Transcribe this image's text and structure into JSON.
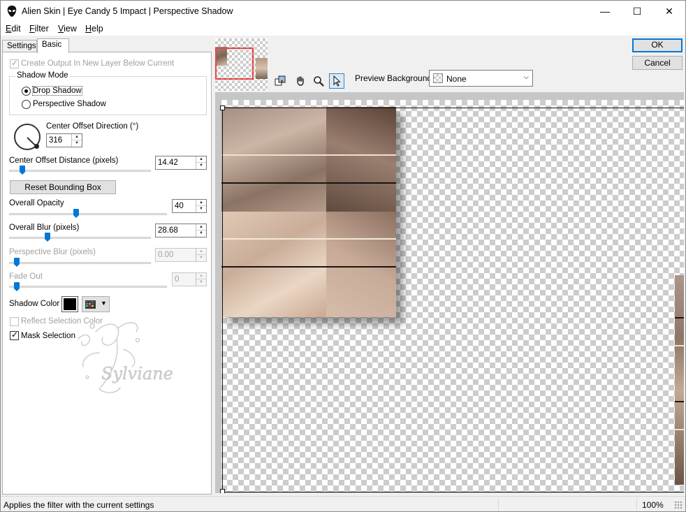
{
  "window": {
    "title": "Alien Skin | Eye Candy 5 Impact | Perspective Shadow",
    "controls": {
      "minimize": "—",
      "maximize": "☐",
      "close": "✕"
    }
  },
  "menu": [
    {
      "key": "E",
      "rest": "dit"
    },
    {
      "key": "F",
      "rest": "ilter"
    },
    {
      "key": "V",
      "rest": "iew"
    },
    {
      "key": "H",
      "rest": "elp"
    }
  ],
  "tabs": {
    "settings": "Settings",
    "basic": "Basic"
  },
  "basic": {
    "create_output": {
      "label": "Create Output In New Layer Below Current",
      "checked": true,
      "enabled": false
    },
    "shadow_mode": {
      "title": "Shadow Mode",
      "drop": "Drop Shadow",
      "perspective": "Perspective Shadow",
      "selected": "Drop Shadow"
    },
    "direction": {
      "label": "Center Offset Direction (°)",
      "value": "316"
    },
    "distance": {
      "label": "Center Offset Distance (pixels)",
      "value": "14.42",
      "slider_fraction": 0.08
    },
    "reset_button": "Reset Bounding Box",
    "opacity": {
      "label": "Overall Opacity",
      "value": "40",
      "slider_fraction": 0.4
    },
    "blur": {
      "label": "Overall Blur (pixels)",
      "value": "28.68",
      "slider_fraction": 0.27
    },
    "perspective_blur": {
      "label": "Perspective Blur (pixels)",
      "value": "0.00",
      "enabled": false
    },
    "fade_out": {
      "label": "Fade Out",
      "value": "0",
      "enabled": false
    },
    "shadow_color": {
      "label": "Shadow Color",
      "color": "#000000"
    },
    "reflect_selection": {
      "label": "Reflect Selection Color",
      "checked": false,
      "enabled": false
    },
    "mask_selection": {
      "label": "Mask Selection",
      "checked": true
    }
  },
  "buttons": {
    "ok": "OK",
    "cancel": "Cancel"
  },
  "preview": {
    "background_label": "Preview Background:",
    "background_value": "None"
  },
  "status": {
    "text": "Applies the filter with the current settings",
    "zoom": "100%"
  },
  "colors": {
    "accent": "#0078d7",
    "checker": "#cccccc"
  }
}
